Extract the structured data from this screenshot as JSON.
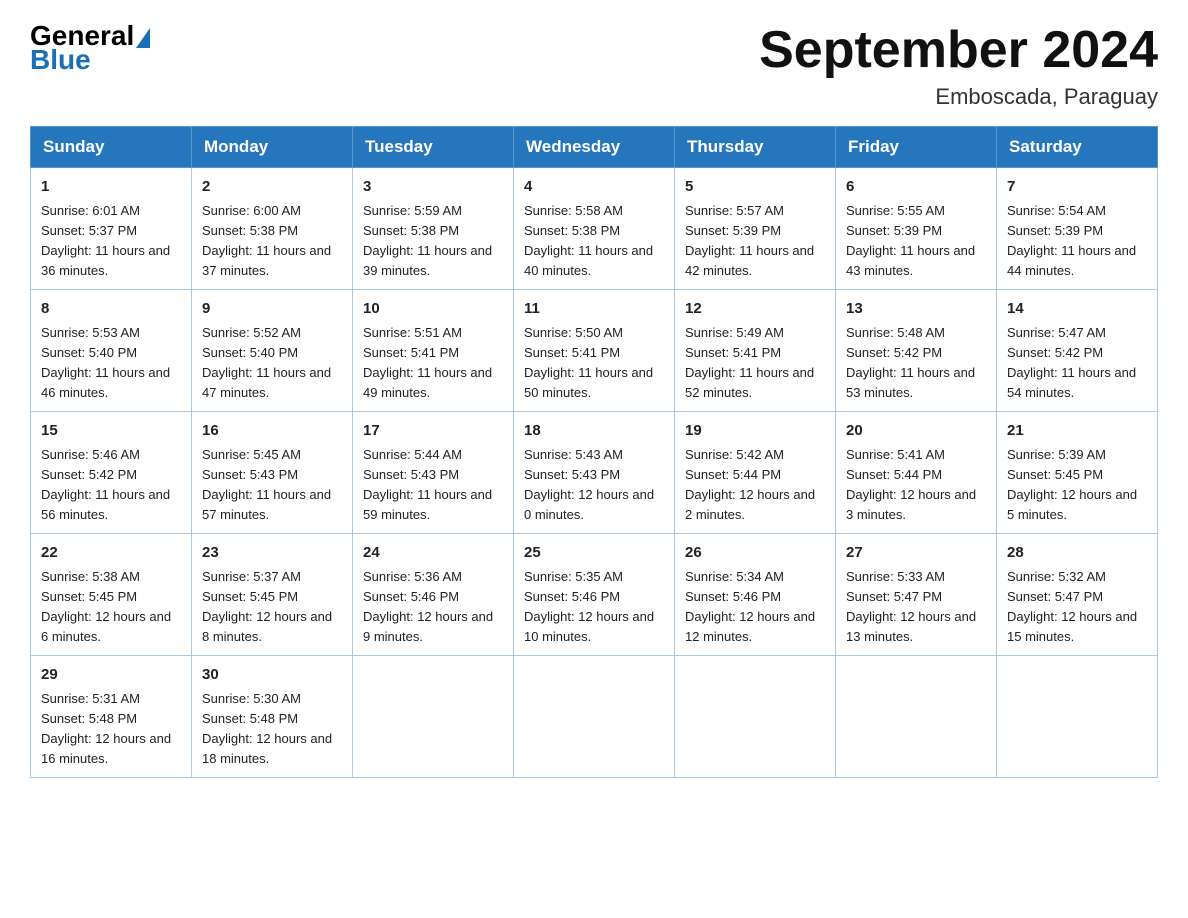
{
  "logo": {
    "general": "General",
    "blue": "Blue"
  },
  "title": "September 2024",
  "location": "Emboscada, Paraguay",
  "days_of_week": [
    "Sunday",
    "Monday",
    "Tuesday",
    "Wednesday",
    "Thursday",
    "Friday",
    "Saturday"
  ],
  "weeks": [
    [
      {
        "day": "1",
        "sunrise": "6:01 AM",
        "sunset": "5:37 PM",
        "daylight": "11 hours and 36 minutes."
      },
      {
        "day": "2",
        "sunrise": "6:00 AM",
        "sunset": "5:38 PM",
        "daylight": "11 hours and 37 minutes."
      },
      {
        "day": "3",
        "sunrise": "5:59 AM",
        "sunset": "5:38 PM",
        "daylight": "11 hours and 39 minutes."
      },
      {
        "day": "4",
        "sunrise": "5:58 AM",
        "sunset": "5:38 PM",
        "daylight": "11 hours and 40 minutes."
      },
      {
        "day": "5",
        "sunrise": "5:57 AM",
        "sunset": "5:39 PM",
        "daylight": "11 hours and 42 minutes."
      },
      {
        "day": "6",
        "sunrise": "5:55 AM",
        "sunset": "5:39 PM",
        "daylight": "11 hours and 43 minutes."
      },
      {
        "day": "7",
        "sunrise": "5:54 AM",
        "sunset": "5:39 PM",
        "daylight": "11 hours and 44 minutes."
      }
    ],
    [
      {
        "day": "8",
        "sunrise": "5:53 AM",
        "sunset": "5:40 PM",
        "daylight": "11 hours and 46 minutes."
      },
      {
        "day": "9",
        "sunrise": "5:52 AM",
        "sunset": "5:40 PM",
        "daylight": "11 hours and 47 minutes."
      },
      {
        "day": "10",
        "sunrise": "5:51 AM",
        "sunset": "5:41 PM",
        "daylight": "11 hours and 49 minutes."
      },
      {
        "day": "11",
        "sunrise": "5:50 AM",
        "sunset": "5:41 PM",
        "daylight": "11 hours and 50 minutes."
      },
      {
        "day": "12",
        "sunrise": "5:49 AM",
        "sunset": "5:41 PM",
        "daylight": "11 hours and 52 minutes."
      },
      {
        "day": "13",
        "sunrise": "5:48 AM",
        "sunset": "5:42 PM",
        "daylight": "11 hours and 53 minutes."
      },
      {
        "day": "14",
        "sunrise": "5:47 AM",
        "sunset": "5:42 PM",
        "daylight": "11 hours and 54 minutes."
      }
    ],
    [
      {
        "day": "15",
        "sunrise": "5:46 AM",
        "sunset": "5:42 PM",
        "daylight": "11 hours and 56 minutes."
      },
      {
        "day": "16",
        "sunrise": "5:45 AM",
        "sunset": "5:43 PM",
        "daylight": "11 hours and 57 minutes."
      },
      {
        "day": "17",
        "sunrise": "5:44 AM",
        "sunset": "5:43 PM",
        "daylight": "11 hours and 59 minutes."
      },
      {
        "day": "18",
        "sunrise": "5:43 AM",
        "sunset": "5:43 PM",
        "daylight": "12 hours and 0 minutes."
      },
      {
        "day": "19",
        "sunrise": "5:42 AM",
        "sunset": "5:44 PM",
        "daylight": "12 hours and 2 minutes."
      },
      {
        "day": "20",
        "sunrise": "5:41 AM",
        "sunset": "5:44 PM",
        "daylight": "12 hours and 3 minutes."
      },
      {
        "day": "21",
        "sunrise": "5:39 AM",
        "sunset": "5:45 PM",
        "daylight": "12 hours and 5 minutes."
      }
    ],
    [
      {
        "day": "22",
        "sunrise": "5:38 AM",
        "sunset": "5:45 PM",
        "daylight": "12 hours and 6 minutes."
      },
      {
        "day": "23",
        "sunrise": "5:37 AM",
        "sunset": "5:45 PM",
        "daylight": "12 hours and 8 minutes."
      },
      {
        "day": "24",
        "sunrise": "5:36 AM",
        "sunset": "5:46 PM",
        "daylight": "12 hours and 9 minutes."
      },
      {
        "day": "25",
        "sunrise": "5:35 AM",
        "sunset": "5:46 PM",
        "daylight": "12 hours and 10 minutes."
      },
      {
        "day": "26",
        "sunrise": "5:34 AM",
        "sunset": "5:46 PM",
        "daylight": "12 hours and 12 minutes."
      },
      {
        "day": "27",
        "sunrise": "5:33 AM",
        "sunset": "5:47 PM",
        "daylight": "12 hours and 13 minutes."
      },
      {
        "day": "28",
        "sunrise": "5:32 AM",
        "sunset": "5:47 PM",
        "daylight": "12 hours and 15 minutes."
      }
    ],
    [
      {
        "day": "29",
        "sunrise": "5:31 AM",
        "sunset": "5:48 PM",
        "daylight": "12 hours and 16 minutes."
      },
      {
        "day": "30",
        "sunrise": "5:30 AM",
        "sunset": "5:48 PM",
        "daylight": "12 hours and 18 minutes."
      },
      null,
      null,
      null,
      null,
      null
    ]
  ]
}
